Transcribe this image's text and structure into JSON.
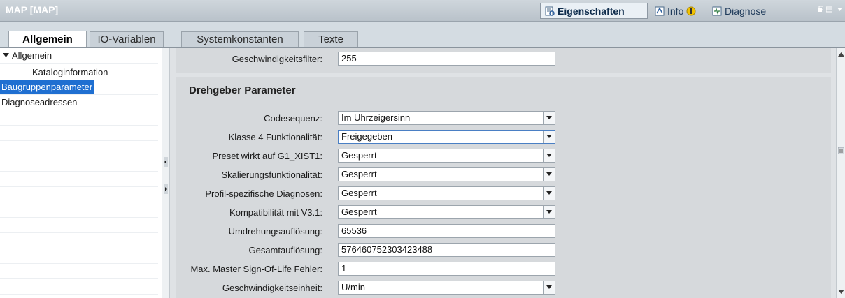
{
  "window": {
    "title": "MAP [MAP]"
  },
  "pane_tabs": [
    {
      "label": "Eigenschaften",
      "icon": "properties-icon",
      "active": true
    },
    {
      "label": "Info",
      "icon": "info-icon"
    },
    {
      "label": "Diagnose",
      "icon": "diagnose-icon"
    }
  ],
  "tabs": [
    {
      "label": "Allgemein",
      "active": true
    },
    {
      "label": "IO-Variablen"
    },
    {
      "label": "Systemkonstanten"
    },
    {
      "label": "Texte"
    }
  ],
  "nav": {
    "items": [
      {
        "label": "Allgemein",
        "expanded": true
      },
      {
        "label": "Kataloginformation"
      },
      {
        "label": "Baugruppenparameter",
        "selected": true
      },
      {
        "label": "Diagnoseadressen"
      }
    ]
  },
  "top_field": {
    "label": "Geschwindigkeitsfilter:",
    "value": "255"
  },
  "section": {
    "title": "Drehgeber Parameter",
    "fields": [
      {
        "label": "Codesequenz:",
        "value": "Im Uhrzeigersinn",
        "type": "dropdown"
      },
      {
        "label": "Klasse 4 Funktionalität:",
        "value": "Freigegeben",
        "type": "dropdown",
        "focused": true
      },
      {
        "label": "Preset wirkt auf G1_XIST1:",
        "value": "Gesperrt",
        "type": "dropdown"
      },
      {
        "label": "Skalierungsfunktionalität:",
        "value": "Gesperrt",
        "type": "dropdown"
      },
      {
        "label": "Profil-spezifische Diagnosen:",
        "value": "Gesperrt",
        "type": "dropdown"
      },
      {
        "label": "Kompatibilität mit V3.1:",
        "value": "Gesperrt",
        "type": "dropdown"
      },
      {
        "label": "Umdrehungsauflösung:",
        "value": "65536",
        "type": "text"
      },
      {
        "label": "Gesamtauflösung:",
        "value": "576460752303423488",
        "type": "text"
      },
      {
        "label": "Max. Master Sign-Of-Life Fehler:",
        "value": "1",
        "type": "text"
      },
      {
        "label": "Geschwindigkeitseinheit:",
        "value": "U/min",
        "type": "dropdown"
      }
    ]
  },
  "colors": {
    "accent": "#1f6fd1",
    "title_text": "#ffffff",
    "info_icon": "#f2c200"
  }
}
